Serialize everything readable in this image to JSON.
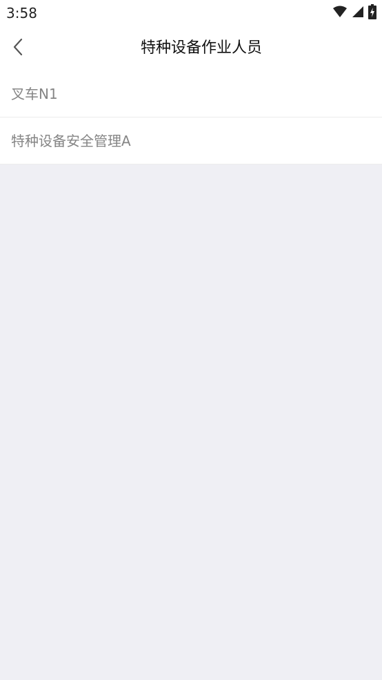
{
  "status_bar": {
    "time": "3:58",
    "icons": [
      "wifi-icon",
      "cellular-signal-icon",
      "battery-charging-icon"
    ]
  },
  "nav_bar": {
    "back_icon": "chevron-left-icon",
    "title": "特种设备作业人员"
  },
  "list": {
    "items": [
      {
        "label": "叉车N1"
      },
      {
        "label": "特种设备安全管理A"
      }
    ]
  },
  "colors": {
    "background": "#efeff4",
    "surface": "#ffffff",
    "title_text": "#111111",
    "item_text": "#858585",
    "divider": "#ececec"
  }
}
